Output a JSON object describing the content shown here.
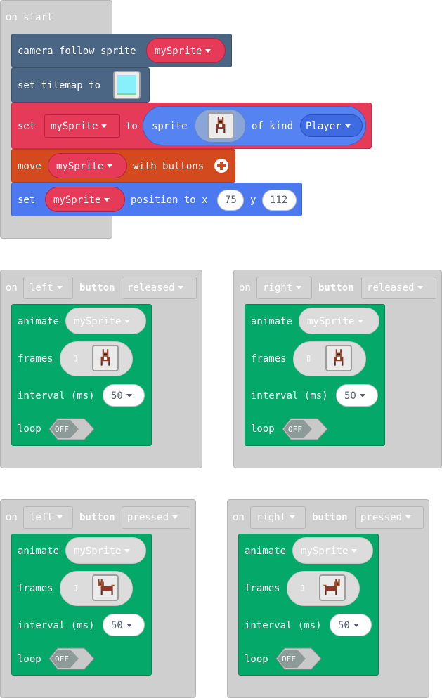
{
  "on_start": {
    "hat_label": "on start",
    "camera": {
      "label": "camera follow sprite",
      "sprite": "mySprite"
    },
    "tilemap": {
      "label": "set tilemap to"
    },
    "set_sprite": {
      "set": "set",
      "var": "mySprite",
      "to": "to",
      "sprite": "sprite",
      "of_kind": "of kind",
      "kind": "Player"
    },
    "move": {
      "move": "move",
      "var": "mySprite",
      "with_buttons": "with buttons"
    },
    "position": {
      "set": "set",
      "var": "mySprite",
      "position_to_x": "position to x",
      "x": "75",
      "y_label": "y",
      "y": "112"
    }
  },
  "events": [
    {
      "on": "on",
      "button_dir": "left",
      "button": "button",
      "state": "released",
      "animate": "animate",
      "sprite": "mySprite",
      "frames": "frames",
      "interval_label": "interval (ms)",
      "interval": "50",
      "loop": "loop",
      "loop_value": "OFF"
    },
    {
      "on": "on",
      "button_dir": "right",
      "button": "button",
      "state": "released",
      "animate": "animate",
      "sprite": "mySprite",
      "frames": "frames",
      "interval_label": "interval (ms)",
      "interval": "50",
      "loop": "loop",
      "loop_value": "OFF"
    },
    {
      "on": "on",
      "button_dir": "left",
      "button": "button",
      "state": "pressed",
      "animate": "animate",
      "sprite": "mySprite",
      "frames": "frames",
      "interval_label": "interval (ms)",
      "interval": "50",
      "loop": "loop",
      "loop_value": "OFF"
    },
    {
      "on": "on",
      "button_dir": "right",
      "button": "button",
      "state": "pressed",
      "animate": "animate",
      "sprite": "mySprite",
      "frames": "frames",
      "interval_label": "interval (ms)",
      "interval": "50",
      "loop": "loop",
      "loop_value": "OFF"
    }
  ],
  "colors": {
    "scene": "#4b6584",
    "sprites": "#e63a59",
    "sprites_blue": "#4c79f0",
    "controller": "#d34a1e",
    "animation": "#04a96a",
    "event_hat": "#cfcfcf"
  },
  "icons": [
    "chevron-down-icon",
    "plus-circle-icon",
    "loop-toggle-icon",
    "frames-placeholder-icon"
  ]
}
